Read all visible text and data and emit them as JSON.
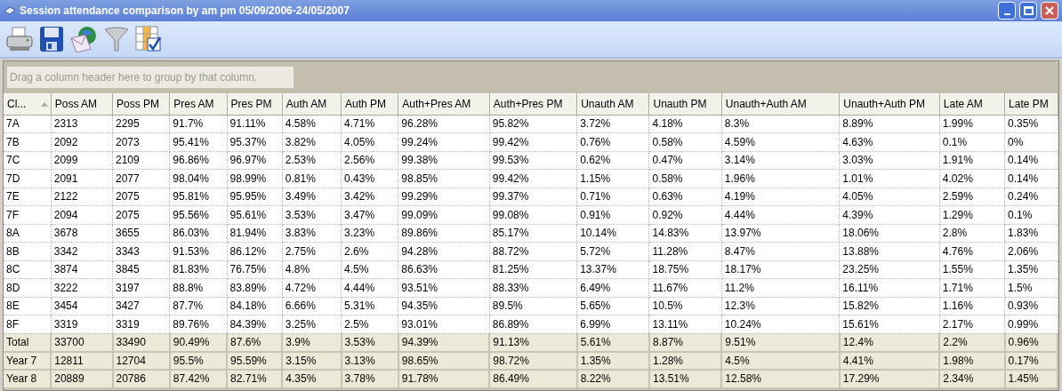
{
  "window": {
    "title": "Session attendance comparison by am pm 05/09/2006-24/05/2007"
  },
  "group_panel": {
    "placeholder": "Drag a column header here to group by that column."
  },
  "table": {
    "columns": [
      {
        "label": "Cl...",
        "sorted": true
      },
      {
        "label": "Poss AM",
        "sorted": false
      },
      {
        "label": "Poss PM",
        "sorted": false
      },
      {
        "label": "Pres AM",
        "sorted": false
      },
      {
        "label": "Pres PM",
        "sorted": false
      },
      {
        "label": "Auth AM",
        "sorted": false
      },
      {
        "label": "Auth PM",
        "sorted": false
      },
      {
        "label": "Auth+Pres AM",
        "sorted": false
      },
      {
        "label": "Auth+Pres PM",
        "sorted": false
      },
      {
        "label": "Unauth AM",
        "sorted": false
      },
      {
        "label": "Unauth PM",
        "sorted": false
      },
      {
        "label": "Unauth+Auth AM",
        "sorted": false
      },
      {
        "label": "Unauth+Auth PM",
        "sorted": false
      },
      {
        "label": "Late AM",
        "sorted": false
      },
      {
        "label": "Late PM",
        "sorted": false
      }
    ],
    "rows": [
      {
        "kind": "class",
        "cells": [
          "7A",
          "2313",
          "2295",
          "91.7%",
          "91.11%",
          "4.58%",
          "4.71%",
          "96.28%",
          "95.82%",
          "3.72%",
          "4.18%",
          "8.3%",
          "8.89%",
          "1.99%",
          "0.35%"
        ]
      },
      {
        "kind": "class",
        "cells": [
          "7B",
          "2092",
          "2073",
          "95.41%",
          "95.37%",
          "3.82%",
          "4.05%",
          "99.24%",
          "99.42%",
          "0.76%",
          "0.58%",
          "4.59%",
          "4.63%",
          "0.1%",
          "0%"
        ]
      },
      {
        "kind": "class",
        "cells": [
          "7C",
          "2099",
          "2109",
          "96.86%",
          "96.97%",
          "2.53%",
          "2.56%",
          "99.38%",
          "99.53%",
          "0.62%",
          "0.47%",
          "3.14%",
          "3.03%",
          "1.91%",
          "0.14%"
        ]
      },
      {
        "kind": "class",
        "cells": [
          "7D",
          "2091",
          "2077",
          "98.04%",
          "98.99%",
          "0.81%",
          "0.43%",
          "98.85%",
          "99.42%",
          "1.15%",
          "0.58%",
          "1.96%",
          "1.01%",
          "4.02%",
          "0.14%"
        ]
      },
      {
        "kind": "class",
        "cells": [
          "7E",
          "2122",
          "2075",
          "95.81%",
          "95.95%",
          "3.49%",
          "3.42%",
          "99.29%",
          "99.37%",
          "0.71%",
          "0.63%",
          "4.19%",
          "4.05%",
          "2.59%",
          "0.24%"
        ]
      },
      {
        "kind": "class",
        "cells": [
          "7F",
          "2094",
          "2075",
          "95.56%",
          "95.61%",
          "3.53%",
          "3.47%",
          "99.09%",
          "99.08%",
          "0.91%",
          "0.92%",
          "4.44%",
          "4.39%",
          "1.29%",
          "0.1%"
        ]
      },
      {
        "kind": "class",
        "cells": [
          "8A",
          "3678",
          "3655",
          "86.03%",
          "81.94%",
          "3.83%",
          "3.23%",
          "89.86%",
          "85.17%",
          "10.14%",
          "14.83%",
          "13.97%",
          "18.06%",
          "2.8%",
          "1.83%"
        ]
      },
      {
        "kind": "class",
        "cells": [
          "8B",
          "3342",
          "3343",
          "91.53%",
          "86.12%",
          "2.75%",
          "2.6%",
          "94.28%",
          "88.72%",
          "5.72%",
          "11.28%",
          "8.47%",
          "13.88%",
          "4.76%",
          "2.06%"
        ]
      },
      {
        "kind": "class",
        "cells": [
          "8C",
          "3874",
          "3845",
          "81.83%",
          "76.75%",
          "4.8%",
          "4.5%",
          "86.63%",
          "81.25%",
          "13.37%",
          "18.75%",
          "18.17%",
          "23.25%",
          "1.55%",
          "1.35%"
        ]
      },
      {
        "kind": "class",
        "cells": [
          "8D",
          "3222",
          "3197",
          "88.8%",
          "83.89%",
          "4.72%",
          "4.44%",
          "93.51%",
          "88.33%",
          "6.49%",
          "11.67%",
          "11.2%",
          "16.11%",
          "1.71%",
          "1.5%"
        ]
      },
      {
        "kind": "class",
        "cells": [
          "8E",
          "3454",
          "3427",
          "87.7%",
          "84.18%",
          "6.66%",
          "5.31%",
          "94.35%",
          "89.5%",
          "5.65%",
          "10.5%",
          "12.3%",
          "15.82%",
          "1.16%",
          "0.93%"
        ]
      },
      {
        "kind": "class",
        "cells": [
          "8F",
          "3319",
          "3319",
          "89.76%",
          "84.39%",
          "3.25%",
          "2.5%",
          "93.01%",
          "86.89%",
          "6.99%",
          "13.11%",
          "10.24%",
          "15.61%",
          "2.17%",
          "0.99%"
        ]
      },
      {
        "kind": "summary",
        "cells": [
          "Total",
          "33700",
          "33490",
          "90.49%",
          "87.6%",
          "3.9%",
          "3.53%",
          "94.39%",
          "91.13%",
          "5.61%",
          "8.87%",
          "9.51%",
          "12.4%",
          "2.2%",
          "0.96%"
        ]
      },
      {
        "kind": "summary",
        "cells": [
          "Year 7",
          "12811",
          "12704",
          "95.5%",
          "95.59%",
          "3.15%",
          "3.13%",
          "98.65%",
          "98.72%",
          "1.35%",
          "1.28%",
          "4.5%",
          "4.41%",
          "1.98%",
          "0.17%"
        ]
      },
      {
        "kind": "summary",
        "cells": [
          "Year 8",
          "20889",
          "20786",
          "87.42%",
          "82.71%",
          "4.35%",
          "3.78%",
          "91.78%",
          "86.49%",
          "8.22%",
          "13.51%",
          "12.58%",
          "17.29%",
          "2.34%",
          "1.45%"
        ]
      }
    ]
  }
}
